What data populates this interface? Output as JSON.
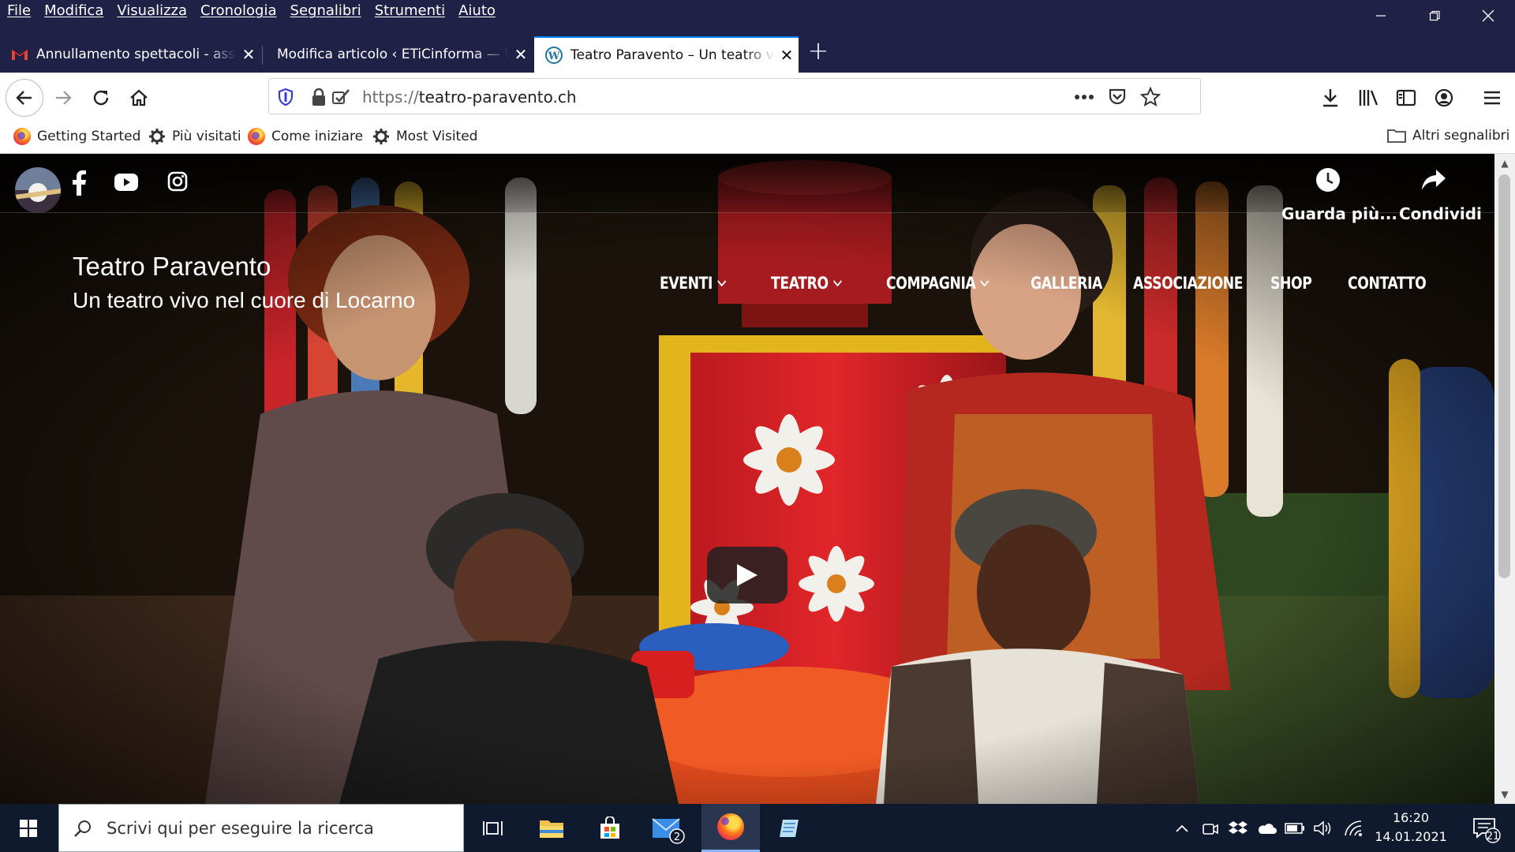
{
  "menubar": {
    "items": [
      "File",
      "Modifica",
      "Visualizza",
      "Cronologia",
      "Segnalibri",
      "Strumenti",
      "Aiuto"
    ]
  },
  "tabs": [
    {
      "title": "Annullamento spettacoli - associazione",
      "icon": "gmail-icon"
    },
    {
      "title": "Modifica articolo ‹ ETiCinforma — WordPress",
      "icon": "none"
    },
    {
      "title": "Teatro Paravento – Un teatro vivo nel cuore di Locarno",
      "icon": "wordpress-icon"
    }
  ],
  "url": {
    "protocol": "https://",
    "host": "teatro-paravento.ch"
  },
  "bookmarks": {
    "items": [
      "Getting Started",
      "Più visitati",
      "Come iniziare",
      "Most Visited"
    ],
    "other": "Altri segnalibri"
  },
  "video": {
    "watch_more": "Guarda più...",
    "share": "Condividi"
  },
  "site": {
    "title": "Teatro Paravento",
    "subtitle": "Un teatro vivo nel cuore di Locarno",
    "nav": [
      "EVENTI",
      "TEATRO",
      "COMPAGNIA",
      "GALLERIA",
      "ASSOCIAZIONE",
      "SHOP",
      "CONTATTO"
    ]
  },
  "taskbar": {
    "search_placeholder": "Scrivi qui per eseguire la ricerca",
    "mail_badge": "2",
    "time": "16:20",
    "date": "14.01.2021",
    "notification_count": "21"
  },
  "colors": {
    "browser_chrome": "#1f2146",
    "accent": "#0a84ff",
    "taskbar": "#101a2e"
  }
}
